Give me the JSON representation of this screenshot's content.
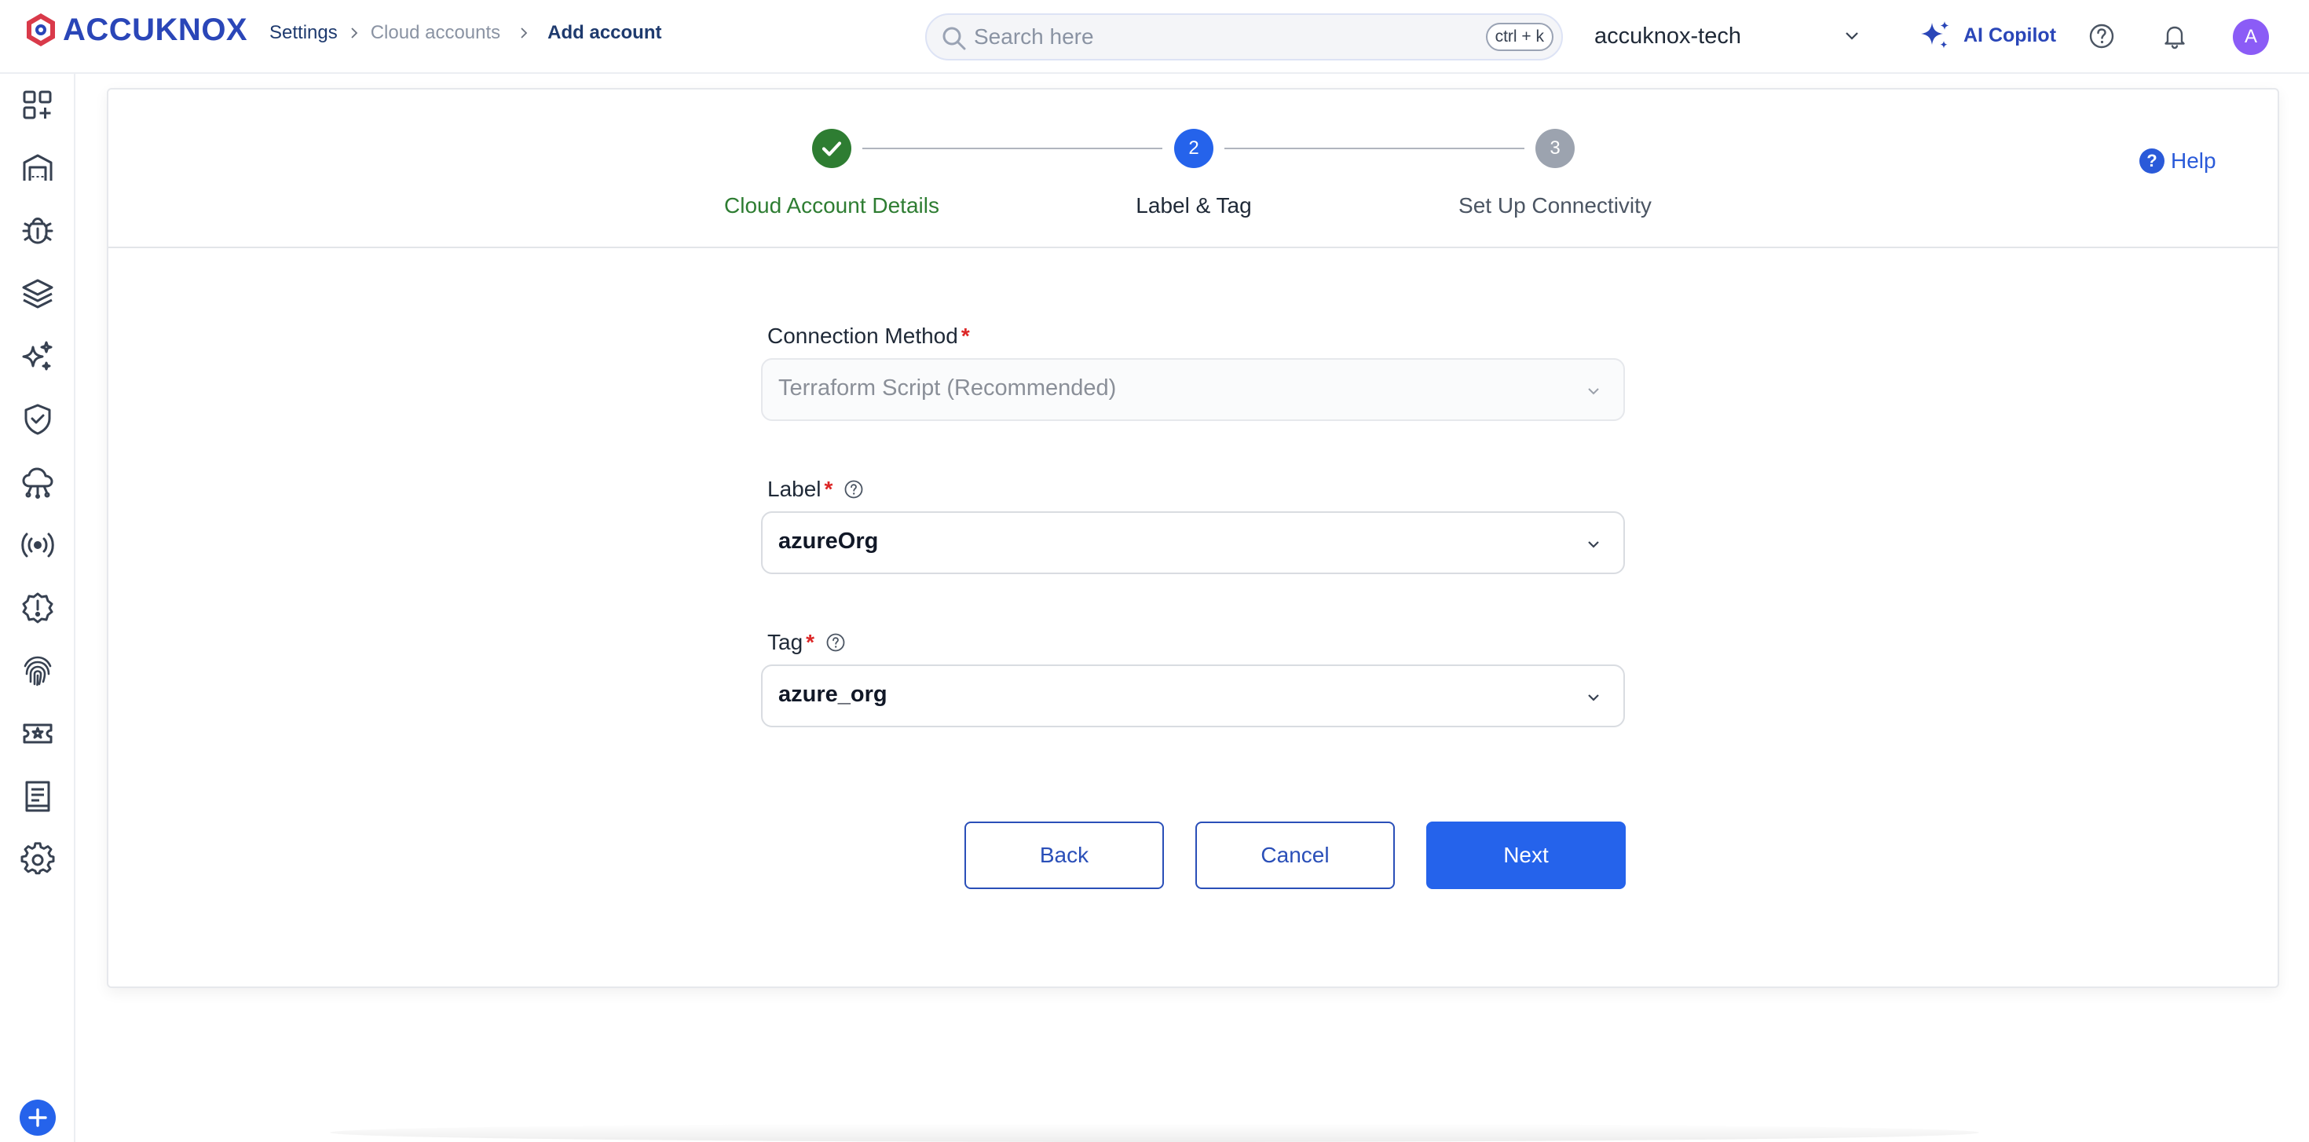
{
  "brand": {
    "name": "ACCUKNOX",
    "accent": "#2a46b8",
    "primary": "#2563eb",
    "success": "#2e7d32"
  },
  "breadcrumb": [
    {
      "label": "Settings"
    },
    {
      "label": "Cloud accounts"
    },
    {
      "label": "Add account"
    }
  ],
  "search": {
    "placeholder": "Search here",
    "shortcut": "ctrl + k",
    "icon": "search-icon"
  },
  "org": {
    "name": "accuknox-tech",
    "icon": "chevron-down-icon"
  },
  "copilot": {
    "label": "AI Copilot",
    "icon": "sparkle-icon"
  },
  "header_icons": [
    "help-circle-icon",
    "bell-icon"
  ],
  "user": {
    "avatar_initial": "A"
  },
  "sidebar": {
    "items": [
      {
        "icon": "dashboard-add-icon"
      },
      {
        "icon": "garage-icon"
      },
      {
        "icon": "bug-icon"
      },
      {
        "icon": "layers-icon"
      },
      {
        "icon": "sparkles-icon"
      },
      {
        "icon": "shield-check-icon"
      },
      {
        "icon": "cloud-network-icon"
      },
      {
        "icon": "broadcast-icon"
      },
      {
        "icon": "alert-badge-icon"
      },
      {
        "icon": "fingerprint-icon"
      },
      {
        "icon": "ticket-icon"
      },
      {
        "icon": "report-icon"
      },
      {
        "icon": "settings-gear-icon"
      }
    ],
    "add_icon": "plus-circle-icon"
  },
  "stepper": {
    "steps": [
      {
        "number": "1",
        "label": "Cloud Account Details",
        "status": "completed"
      },
      {
        "number": "2",
        "label": "Label & Tag",
        "status": "active"
      },
      {
        "number": "3",
        "label": "Set Up Connectivity",
        "status": "pending"
      }
    ]
  },
  "help": {
    "label": "Help",
    "glyph": "?"
  },
  "form": {
    "connection_method": {
      "label": "Connection Method",
      "required_mark": "*",
      "value": "Terraform Script (Recommended)",
      "disabled": true
    },
    "label": {
      "label": "Label",
      "required_mark": "*",
      "value": "azureOrg"
    },
    "tag": {
      "label": "Tag",
      "required_mark": "*",
      "value": "azure_org"
    }
  },
  "buttons": {
    "back": "Back",
    "cancel": "Cancel",
    "next": "Next"
  }
}
